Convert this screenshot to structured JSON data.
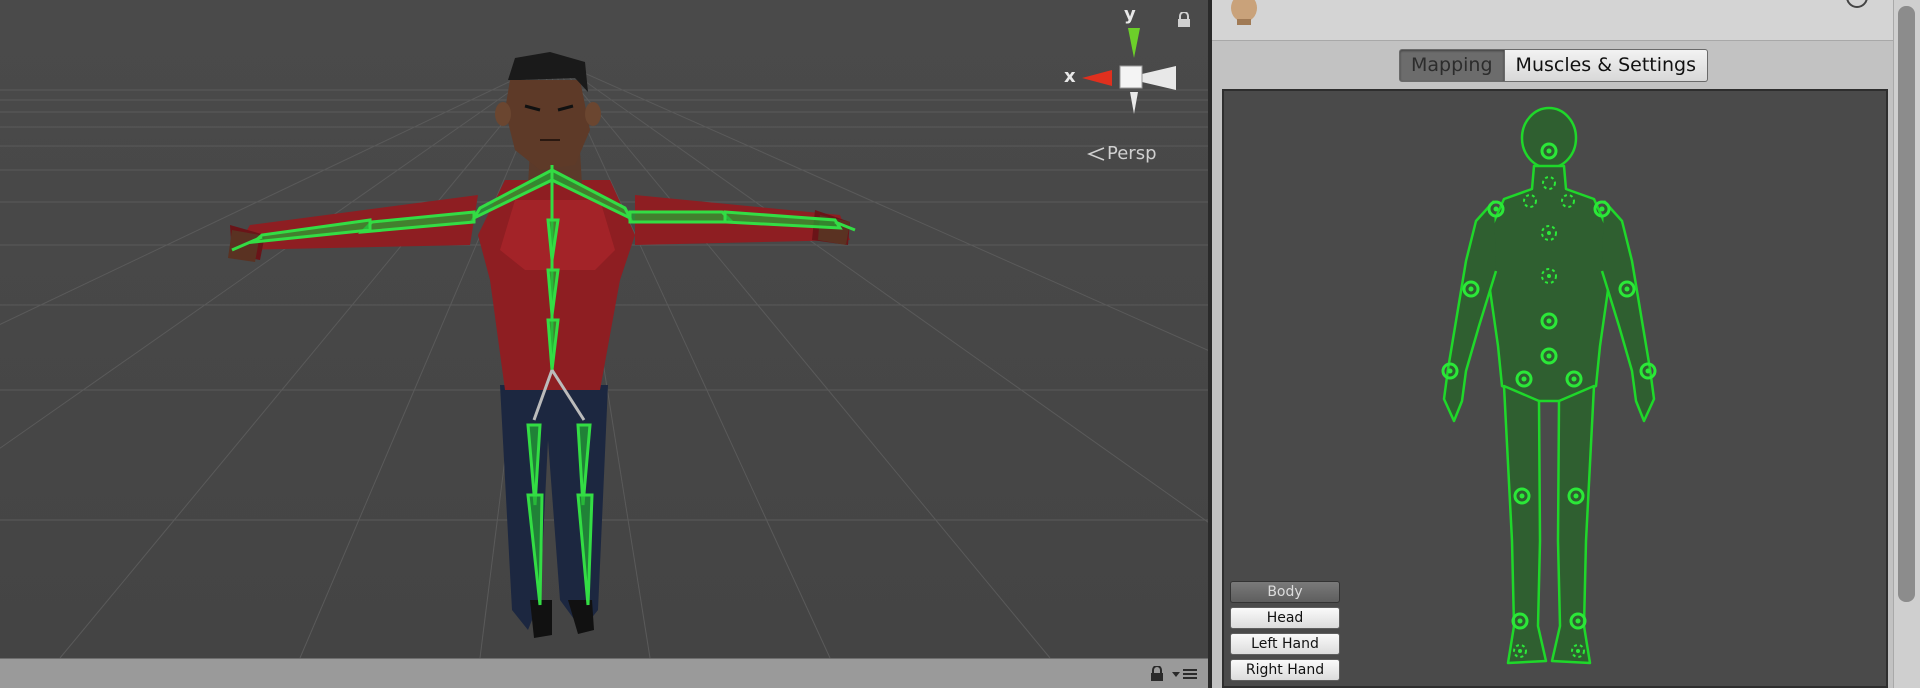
{
  "scene": {
    "gizmo": {
      "y_label": "y",
      "x_label": "x"
    },
    "projection_label": "Persp"
  },
  "avatar_panel": {
    "tabs": [
      {
        "label": "Mapping",
        "active": true
      },
      {
        "label": "Muscles & Settings",
        "active": false
      }
    ],
    "body_parts": [
      {
        "label": "Body",
        "active": true
      },
      {
        "label": "Head",
        "active": false
      },
      {
        "label": "Left Hand",
        "active": false
      },
      {
        "label": "Right Hand",
        "active": false
      }
    ]
  },
  "colors": {
    "scene_background": "#474747",
    "bone_green": "#2ecc40",
    "figure_fill": "#2f5f30",
    "figure_outline": "#1fd82a",
    "gizmo_x": "#e0301e",
    "gizmo_y": "#6ccf2a"
  },
  "icons": [
    "lock-icon",
    "layers-menu-icon",
    "persp-arrow-icon",
    "avatar-head-icon"
  ]
}
